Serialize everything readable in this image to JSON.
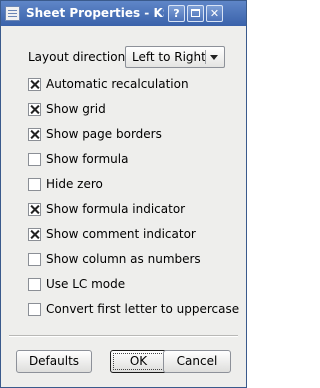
{
  "window": {
    "title": "Sheet Properties - KSprea",
    "help_label": "?",
    "close_label": "✕"
  },
  "layout": {
    "label": "Layout direction:",
    "value": "Left to Right"
  },
  "options": [
    {
      "label": "Automatic recalculation",
      "checked": true
    },
    {
      "label": "Show grid",
      "checked": true
    },
    {
      "label": "Show page borders",
      "checked": true
    },
    {
      "label": "Show formula",
      "checked": false
    },
    {
      "label": "Hide zero",
      "checked": false
    },
    {
      "label": "Show formula indicator",
      "checked": true
    },
    {
      "label": "Show comment indicator",
      "checked": true
    },
    {
      "label": "Show column as numbers",
      "checked": false
    },
    {
      "label": "Use LC mode",
      "checked": false
    },
    {
      "label": "Convert first letter to uppercase",
      "checked": false
    }
  ],
  "buttons": {
    "defaults": "Defaults",
    "ok": "OK",
    "cancel": "Cancel"
  }
}
